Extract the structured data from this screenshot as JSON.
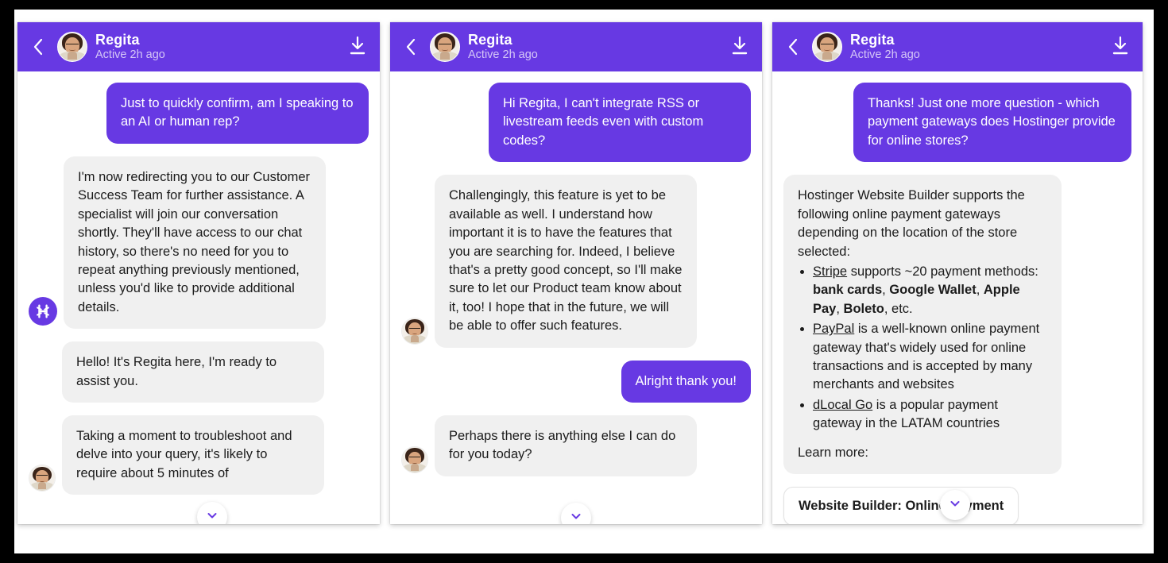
{
  "colors": {
    "brand_purple": "#6739E3",
    "bubble_gray": "#F0F0F0",
    "page_background": "#FFFFFF",
    "outer_frame": "#000000",
    "status_text": "#D5C6F7"
  },
  "header": {
    "back_icon": "chevron-left-icon",
    "avatar_icon": "agent-avatar",
    "name": "Regita",
    "status": "Active 2h ago",
    "download_icon": "download-icon"
  },
  "scroll_button": {
    "icon": "chevron-down-icon",
    "label": "Scroll to bottom"
  },
  "panels": [
    {
      "id": "panel-1",
      "messages": [
        {
          "side": "out",
          "avatar": "none",
          "text": "Just to quickly confirm, am I speaking to an AI or human rep?"
        },
        {
          "side": "in",
          "avatar": "hostinger-logo",
          "text": "I'm now redirecting you to our Customer Success Team for further assistance. A specialist will join our conversation shortly. They'll have access to our chat history, so there's no need for you to repeat anything previously mentioned, unless you'd like to provide additional details."
        },
        {
          "side": "in",
          "avatar": "none",
          "text": "Hello! It's Regita here, I'm ready to assist you."
        },
        {
          "side": "in",
          "avatar": "agent-avatar",
          "text": "Taking a moment to troubleshoot and delve into your query, it's likely to require about 5 minutes of"
        }
      ]
    },
    {
      "id": "panel-2",
      "messages": [
        {
          "side": "out",
          "avatar": "none",
          "text": "Hi Regita, I can't integrate RSS or livestream feeds even with custom codes?"
        },
        {
          "side": "in",
          "avatar": "agent-avatar",
          "text": "Challengingly, this feature is yet to be available as well. I understand how important it is to have the features that you are searching for. Indeed, I believe that's a pretty good concept, so I'll make sure to let our Product team know about it, too! I hope that in the future, we will be able to offer such features."
        },
        {
          "side": "out",
          "avatar": "none",
          "text": "Alright thank you!"
        },
        {
          "side": "in",
          "avatar": "agent-avatar",
          "text": "Perhaps there is anything else I can do for you today?"
        }
      ]
    },
    {
      "id": "panel-3",
      "messages": [
        {
          "side": "out",
          "avatar": "none",
          "text": "Thanks! Just one more question - which payment gateways does Hostinger provide for online stores?"
        }
      ],
      "answer": {
        "intro": "Hostinger Website Builder supports the following online payment gateways depending on the location of the store selected:",
        "bullets": [
          {
            "link": "Stripe",
            "before": " supports ~20 payment methods: ",
            "bold_items": [
              "bank cards",
              "Google Wallet",
              "Apple Pay",
              "Boleto"
            ],
            "after": ", etc."
          },
          {
            "link": "PayPal",
            "before": " is a well-known online payment gateway that's widely used for online transactions and is accepted by many merchants and websites",
            "bold_items": [],
            "after": ""
          },
          {
            "link": "dLocal Go",
            "before": " is a popular payment gateway in the LATAM countries",
            "bold_items": [],
            "after": ""
          }
        ],
        "learn_more": "Learn more:"
      },
      "link_card": {
        "title": "Website Builder: Online payment"
      }
    }
  ]
}
